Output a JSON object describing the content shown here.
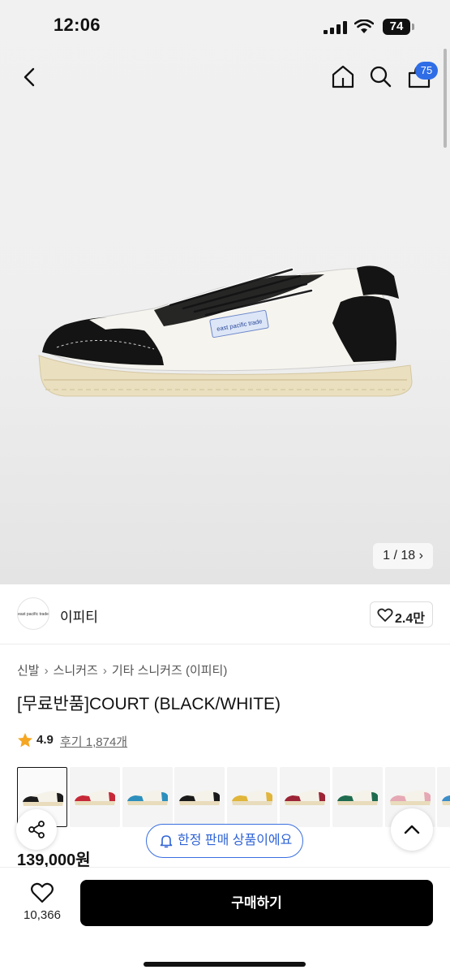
{
  "status_bar": {
    "time": "12:06",
    "battery": "74"
  },
  "header": {
    "cart_badge": "75"
  },
  "gallery": {
    "counter": "1 / 18",
    "shoe_label": "east pacific trade"
  },
  "brand": {
    "logo_text": "east pacific trade",
    "name": "이피티",
    "likes": "2.4만"
  },
  "breadcrumb": [
    "신발",
    "스니커즈",
    "기타 스니커즈 (이피티)"
  ],
  "product": {
    "title": "[무료반품]COURT (BLACK/WHITE)",
    "rating": "4.9",
    "reviews": "후기 1,874개",
    "price": "139,000원"
  },
  "color_swatches": [
    {
      "name": "black",
      "color": "#1c1c1c",
      "selected": true
    },
    {
      "name": "red",
      "color": "#c62838"
    },
    {
      "name": "beige-blue",
      "color": "#2d8fbd"
    },
    {
      "name": "all-black",
      "color": "#1a1a1a"
    },
    {
      "name": "yellow",
      "color": "#e0b53a"
    },
    {
      "name": "burgundy",
      "color": "#9c2436"
    },
    {
      "name": "green",
      "color": "#1f6b4f"
    },
    {
      "name": "pink",
      "color": "#e5a8b4"
    },
    {
      "name": "blue",
      "color": "#3b8ec9"
    }
  ],
  "notice_pill": {
    "label": "한정 판매 상품이에요"
  },
  "bottom_bar": {
    "wish_count": "10,366",
    "buy_label": "구매하기"
  },
  "colors": {
    "accent_blue": "#2f6de6",
    "star": "#f5a623"
  }
}
